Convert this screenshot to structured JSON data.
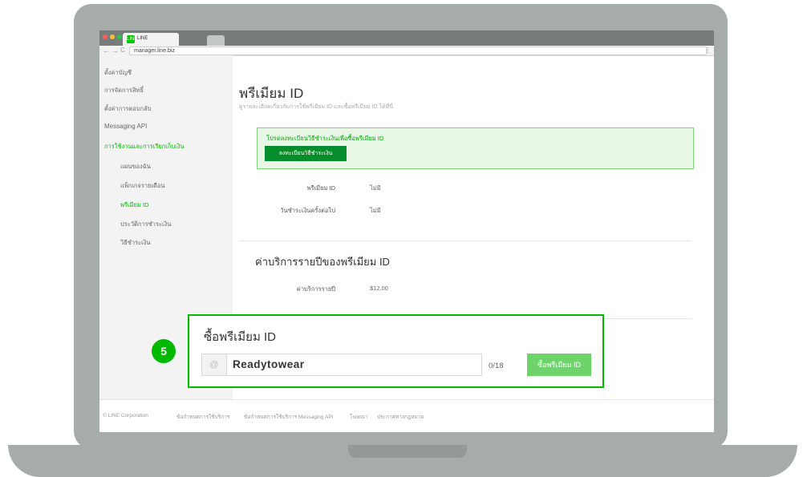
{
  "browser": {
    "tab_title": "LINE",
    "tab_logo": "LINE",
    "back_icon": "←",
    "forward_icon": "→",
    "reload_icon": "C",
    "url": "manager.line.biz",
    "menu_icon": "⋮"
  },
  "sidebar": {
    "items": [
      {
        "label": "ตั้งค่าบัญชี"
      },
      {
        "label": "การจัดการสิทธิ์"
      },
      {
        "label": "ตั้งค่าการตอบกลับ"
      },
      {
        "label": "Messaging API"
      },
      {
        "label": "การใช้งานและการเรียกเก็บเงิน"
      },
      {
        "label": "แผนของฉัน"
      },
      {
        "label": "แพ็กเกจรายเดือน"
      },
      {
        "label": "พรีเมียม ID"
      },
      {
        "label": "ประวัติการชำระเงิน"
      },
      {
        "label": "วิธีชำระเงิน"
      }
    ]
  },
  "main": {
    "title": "พรีเมียม ID",
    "subtitle": "ดูรายละเอียดเกี่ยวกับการใช้พรีเมียม ID และซื้อพรีเมียม ID ได้ที่นี่",
    "notice": {
      "text": "โปรดลงทะเบียนวิธีชำระเงินเพื่อซื้อพรีเมียม ID",
      "button": "ลงทะเบียนวิธีชำระเงิน"
    },
    "info_rows": [
      {
        "label": "พรีเมียม ID",
        "value": "ไม่มี"
      },
      {
        "label": "วันชำระเงินครั้งต่อไป",
        "value": "ไม่มี"
      }
    ],
    "fee_section_title": "ค่าบริการรายปีของพรีเมียม ID",
    "fee_row": {
      "label": "ค่าบริการรายปี",
      "value": "$12.00"
    }
  },
  "footer": {
    "copyright": "© LINE Corporation",
    "links": [
      "ข้อกำหนดการใช้บริการ",
      "ข้อกำหนดการใช้บริการ Messaging API",
      "โฆษณา",
      "ประกาศทางกฎหมาย"
    ]
  },
  "highlight": {
    "title": "ซื้อพรีเมียม ID",
    "at_symbol": "@",
    "input_value": "Readytowear",
    "counter": "0/18",
    "button": "ซื้อพรีเมียม ID"
  },
  "step_badge": "5",
  "colors": {
    "accent": "#00b900",
    "notice_bg": "#e8f7e6",
    "notice_button": "#058d2b",
    "buy_button": "#6fd36b",
    "laptop": "#a6aca9"
  }
}
